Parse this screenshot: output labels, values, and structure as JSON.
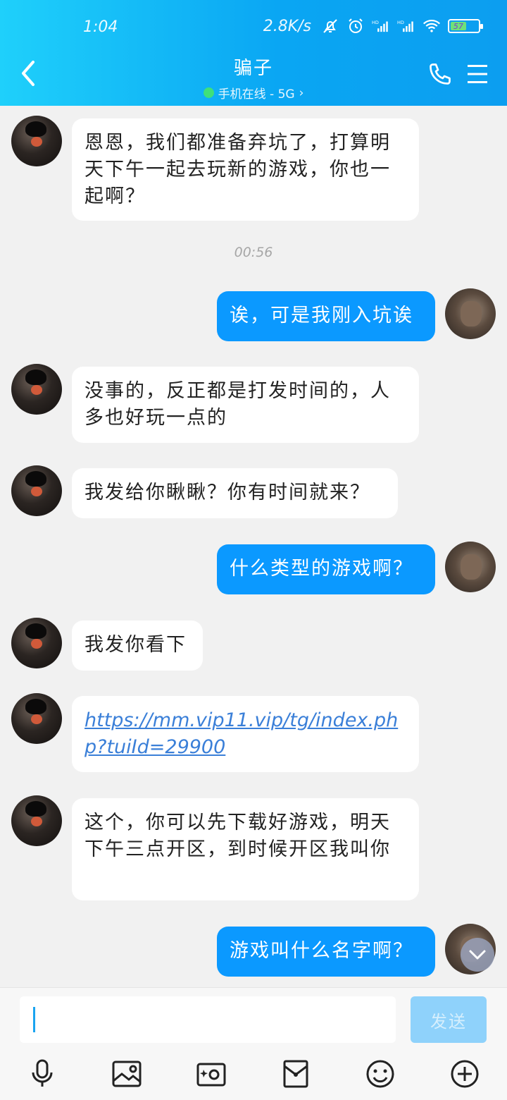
{
  "status_bar": {
    "time": "1:04",
    "net_speed": "2.8K/s",
    "battery": "57",
    "icons": [
      "mute-bell-icon",
      "alarm-icon",
      "hd-signal-icon",
      "hd-signal-icon",
      "wifi-icon",
      "battery-icon"
    ]
  },
  "header": {
    "contact_name": "骗子",
    "online_status": "手机在线 - 5G",
    "online_chevron": "›"
  },
  "messages": [
    {
      "dir": "in",
      "text": "恩恩，我们都准备弃坑了，打算明天下午一起去玩新的游戏，你也一起啊？"
    },
    {
      "type": "time",
      "text": "00:56"
    },
    {
      "dir": "out",
      "text": "诶，可是我刚入坑诶"
    },
    {
      "dir": "in",
      "text": "没事的，反正都是打发时间的，人多也好玩一点的"
    },
    {
      "dir": "in",
      "text": "我发给你瞅瞅？你有时间就来？"
    },
    {
      "dir": "out",
      "text": "什么类型的游戏啊？"
    },
    {
      "dir": "in",
      "text": "我发你看下"
    },
    {
      "dir": "in",
      "link": true,
      "text": "https://mm.vip11.vip/tg/index.php?tuiId=29900"
    },
    {
      "dir": "in",
      "text": "这个，你可以先下载好游戏，明天下午三点开区，到时候开区我叫你"
    },
    {
      "dir": "out",
      "text": "游戏叫什么名字啊？"
    }
  ],
  "input": {
    "value": "",
    "send_label": "发送"
  },
  "toolbar": [
    "microphone-icon",
    "image-icon",
    "camera-icon",
    "red-packet-icon",
    "emoji-icon",
    "plus-icon"
  ],
  "colors": {
    "header_start": "#1fd0fb",
    "header_end": "#0c9ef0",
    "out_bubble": "#0b99ff",
    "in_bubble": "#ffffff",
    "background": "#f1f1f1",
    "send_button": "#8fd2fb",
    "link": "#3a7fd8"
  }
}
